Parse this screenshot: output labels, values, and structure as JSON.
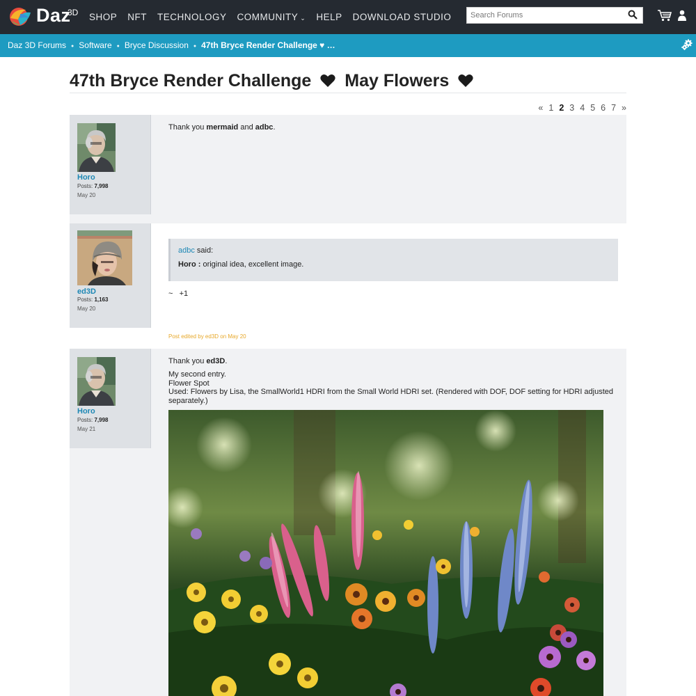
{
  "brand": {
    "name": "Daz",
    "sup": "3D"
  },
  "nav": {
    "items": [
      "SHOP",
      "NFT",
      "TECHNOLOGY",
      "COMMUNITY",
      "HELP",
      "DOWNLOAD STUDIO"
    ]
  },
  "search": {
    "placeholder": "Search Forums"
  },
  "breadcrumb": [
    "Daz 3D Forums",
    "Software",
    "Bryce Discussion",
    "47th Bryce Render Challenge ♥ …"
  ],
  "thread": {
    "title_part1": "47th Bryce Render Challenge",
    "title_part2": "May Flowers"
  },
  "pager": {
    "prev": "«",
    "pages": [
      "1",
      "2",
      "3",
      "4",
      "5",
      "6",
      "7"
    ],
    "current": "2",
    "next": "»"
  },
  "posts": [
    {
      "author": "Horo",
      "posts_label": "Posts:",
      "posts_count": "7,998",
      "date": "May 20",
      "text_prefix": "Thank you ",
      "text_bold1": "mermaid",
      "text_mid": " and ",
      "text_bold2": "adbc",
      "text_suffix": "."
    },
    {
      "author": "ed3D",
      "posts_label": "Posts:",
      "posts_count": "1,163",
      "date": "May 20",
      "quote_author": "adbc",
      "quote_said": " said:",
      "quote_bold": "Horo :",
      "quote_text": " original idea, excellent image.",
      "reply": "~   +1",
      "edited": "Post edited by ed3D on May 20"
    },
    {
      "author": "Horo",
      "posts_label": "Posts:",
      "posts_count": "7,998",
      "date": "May 21",
      "text_prefix": "Thank you ",
      "text_bold1": "ed3D",
      "text_suffix": ".",
      "line1": "My second entry.",
      "line2": "Flower Spot",
      "line3": "Used: Flowers by Lisa, the SmallWorld1 HDRI from the Small World HDRI set. (Rendered with DOF, DOF setting for HDRI adjusted separately.)"
    }
  ],
  "colors": {
    "topbar": "#252a31",
    "breadcrumb_bar": "#1e9bc1",
    "author_link": "#1e88b5",
    "post_bg": "#f1f2f4",
    "author_bg": "#dee1e5",
    "edited": "#e7a82a"
  }
}
